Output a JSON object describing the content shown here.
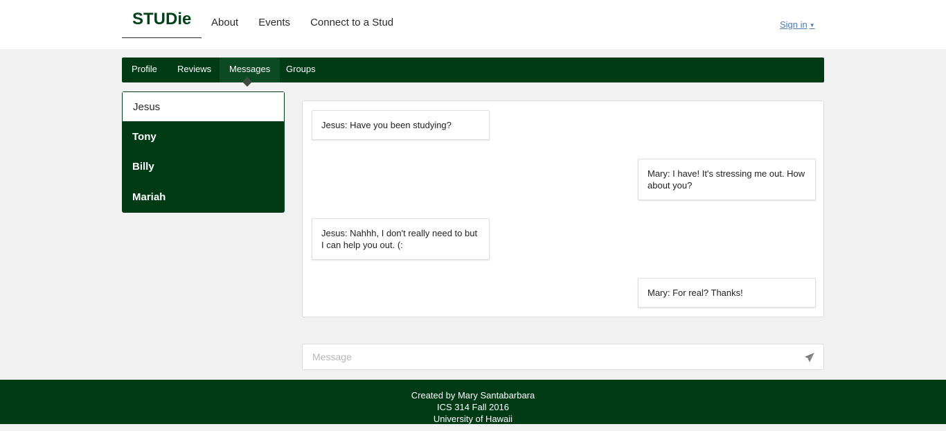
{
  "header": {
    "brand": "STUDie",
    "nav": [
      "About",
      "Events",
      "Connect to a Stud"
    ],
    "signin": "Sign in",
    "signin_caret": "▼"
  },
  "subnav": {
    "tabs": [
      "Profile",
      "Reviews",
      "Messages",
      "Groups"
    ],
    "active": "Messages"
  },
  "contacts": [
    "Jesus",
    "Tony",
    "Billy",
    "Mariah"
  ],
  "active_contact": "Jesus",
  "messages": [
    {
      "from": "Jesus",
      "text": "Jesus: Have you been studying?"
    },
    {
      "from": "Mary",
      "text": "Mary: I have! It's stressing me out. How about you?"
    },
    {
      "from": "Jesus",
      "text": "Jesus: Nahhh, I don't really need to but I can help you out. (:"
    },
    {
      "from": "Mary",
      "text": "Mary: For real? Thanks!"
    }
  ],
  "composer": {
    "placeholder": "Message",
    "send_icon": "paper-plane-icon"
  },
  "footer": {
    "line1": "Created by Mary Santabarbara",
    "line2": "ICS 314 Fall 2016",
    "line3": "University of Hawaii"
  },
  "colors": {
    "brand_green": "#003b16",
    "background": "#f2f1f1",
    "link": "#4a7bb3"
  }
}
